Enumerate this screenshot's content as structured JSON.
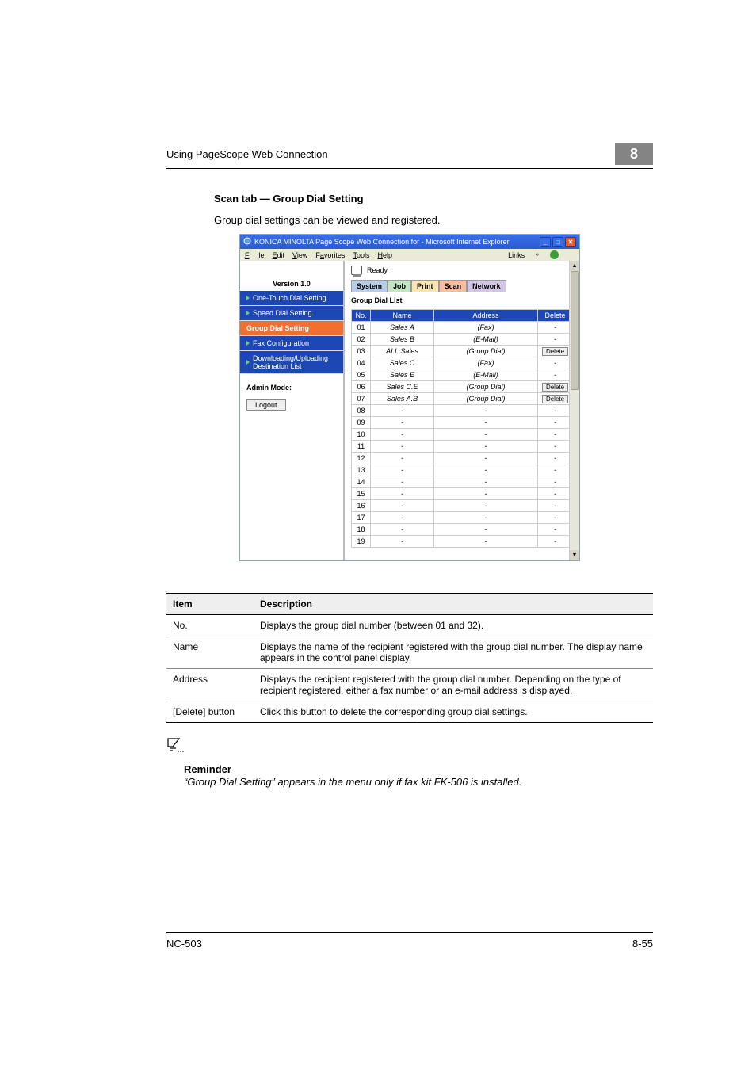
{
  "header": {
    "title": "Using PageScope Web Connection",
    "num": "8"
  },
  "section": {
    "title": "Scan tab — Group Dial Setting",
    "desc": "Group dial settings can be viewed and registered."
  },
  "browser": {
    "title": "KONICA MINOLTA Page Scope Web Connection for      - Microsoft Internet Explorer",
    "menu": {
      "file": "File",
      "edit": "Edit",
      "view": "View",
      "favorites": "Favorites",
      "tools": "Tools",
      "help": "Help",
      "links": "Links"
    },
    "version_label": "Version 1.0",
    "status_label": "Ready",
    "tabs": {
      "system": "System",
      "job": "Job",
      "print": "Print",
      "scan": "Scan",
      "network": "Network"
    },
    "sidebar": {
      "one_touch": "One-Touch Dial Setting",
      "speed": "Speed Dial Setting",
      "group": "Group Dial Setting",
      "fax_conf": "Fax Configuration",
      "download": "Downloading/Uploading Destination List",
      "admin_mode": "Admin Mode:",
      "logout": "Logout"
    },
    "content": {
      "title": "Group Dial List",
      "headers": {
        "no": "No.",
        "name": "Name",
        "address": "Address",
        "delete": "Delete"
      },
      "rows": [
        {
          "no": "01",
          "name": "Sales A",
          "address": "(Fax)",
          "del": false
        },
        {
          "no": "02",
          "name": "Sales B",
          "address": "(E-Mail)",
          "del": false
        },
        {
          "no": "03",
          "name": "ALL Sales",
          "address": "(Group Dial)",
          "del": true
        },
        {
          "no": "04",
          "name": "Sales C",
          "address": "(Fax)",
          "del": false
        },
        {
          "no": "05",
          "name": "Sales E",
          "address": "(E-Mail)",
          "del": false
        },
        {
          "no": "06",
          "name": "Sales C.E",
          "address": "(Group Dial)",
          "del": true
        },
        {
          "no": "07",
          "name": "Sales A.B",
          "address": "(Group Dial)",
          "del": true
        },
        {
          "no": "08",
          "name": "-",
          "address": "-",
          "del": false
        },
        {
          "no": "09",
          "name": "-",
          "address": "-",
          "del": false
        },
        {
          "no": "10",
          "name": "-",
          "address": "-",
          "del": false
        },
        {
          "no": "11",
          "name": "-",
          "address": "-",
          "del": false
        },
        {
          "no": "12",
          "name": "-",
          "address": "-",
          "del": false
        },
        {
          "no": "13",
          "name": "-",
          "address": "-",
          "del": false
        },
        {
          "no": "14",
          "name": "-",
          "address": "-",
          "del": false
        },
        {
          "no": "15",
          "name": "-",
          "address": "-",
          "del": false
        },
        {
          "no": "16",
          "name": "-",
          "address": "-",
          "del": false
        },
        {
          "no": "17",
          "name": "-",
          "address": "-",
          "del": false
        },
        {
          "no": "18",
          "name": "-",
          "address": "-",
          "del": false
        },
        {
          "no": "19",
          "name": "-",
          "address": "-",
          "del": false
        }
      ],
      "delete_label": "Delete"
    }
  },
  "desc_table": {
    "h_item": "Item",
    "h_desc": "Description",
    "rows": [
      {
        "item": "No.",
        "desc": "Displays the group dial number (between 01 and 32)."
      },
      {
        "item": "Name",
        "desc": "Displays the name of the recipient registered with the group dial number. The display name appears in the control panel display."
      },
      {
        "item": "Address",
        "desc": "Displays the recipient registered with the group dial number. Depending on the type of recipient registered, either a fax number or an e-mail address is displayed."
      },
      {
        "item": "[Delete] button",
        "desc": "Click this button to delete the corresponding group dial settings."
      }
    ]
  },
  "reminder": {
    "title": "Reminder",
    "text": "“Group Dial Setting” appears in the menu only if fax kit FK-506 is installed."
  },
  "footer": {
    "left": "NC-503",
    "right": "8-55"
  }
}
